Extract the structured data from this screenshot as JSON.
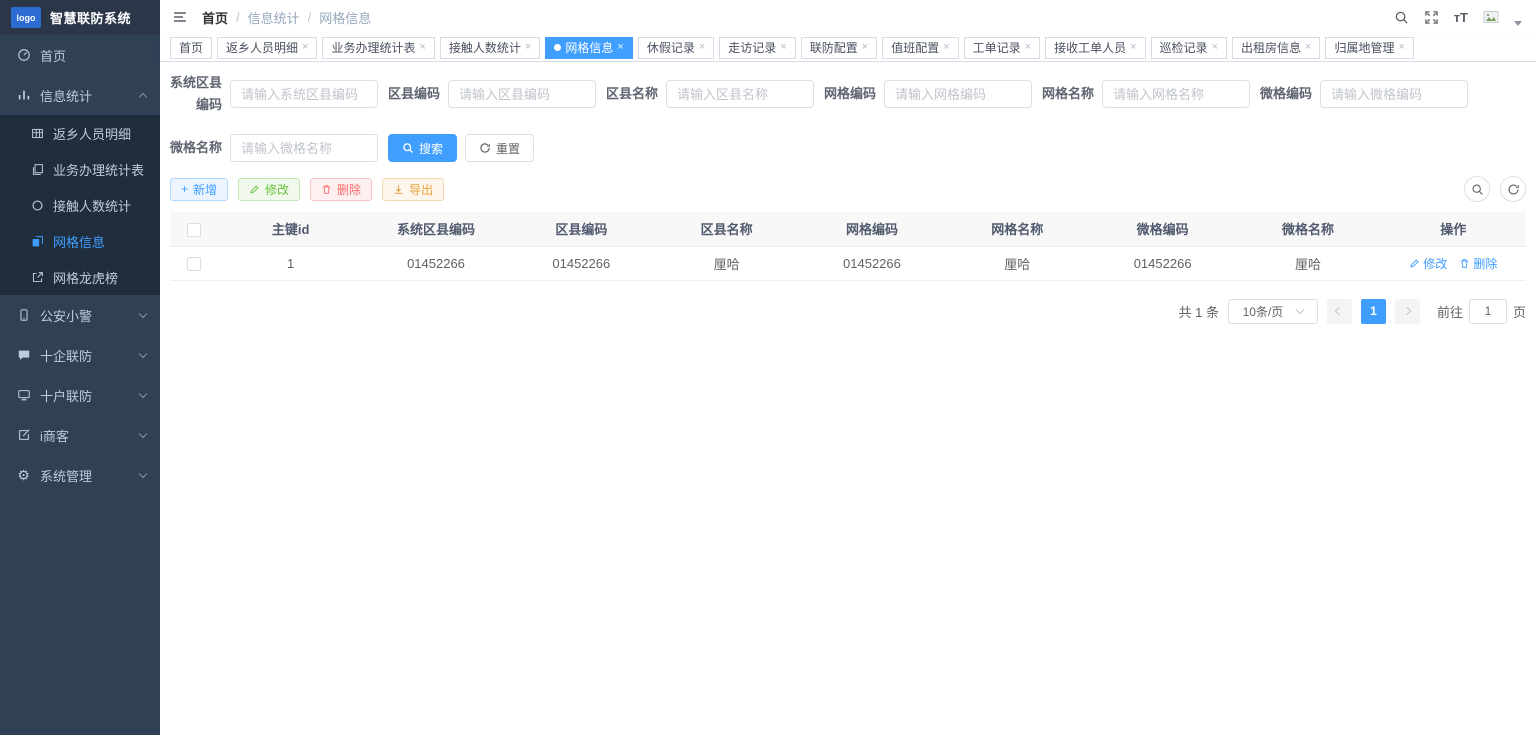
{
  "app": {
    "logo_text": "logo",
    "title": "智慧联防系统"
  },
  "sidebar": {
    "home": "首页",
    "info_stats": "信息统计",
    "info_children": [
      "返乡人员明细",
      "业务办理统计表",
      "接触人数统计",
      "网格信息",
      "网格龙虎榜"
    ],
    "active_child": "网格信息",
    "groups": [
      "公安小警",
      "十企联防",
      "十户联防",
      "i商客",
      "系统管理"
    ]
  },
  "breadcrumb": [
    "首页",
    "信息统计",
    "网格信息"
  ],
  "tabs": [
    "首页",
    "返乡人员明细",
    "业务办理统计表",
    "接触人数统计",
    "网格信息",
    "休假记录",
    "走访记录",
    "联防配置",
    "值班配置",
    "工单记录",
    "接收工单人员",
    "巡检记录",
    "出租房信息",
    "归属地管理"
  ],
  "active_tab": "网格信息",
  "filters": {
    "fields": [
      {
        "label": "系统区县编码",
        "placeholder": "请输入系统区县编码"
      },
      {
        "label": "区县编码",
        "placeholder": "请输入区县编码"
      },
      {
        "label": "区县名称",
        "placeholder": "请输入区县名称"
      },
      {
        "label": "网格编码",
        "placeholder": "请输入网格编码"
      },
      {
        "label": "网格名称",
        "placeholder": "请输入网格名称"
      },
      {
        "label": "微格编码",
        "placeholder": "请输入微格编码"
      },
      {
        "label": "微格名称",
        "placeholder": "请输入微格名称"
      }
    ],
    "search": "搜索",
    "reset": "重置"
  },
  "toolbar": {
    "add": "新增",
    "edit": "修改",
    "del": "删除",
    "export": "导出"
  },
  "table": {
    "columns": [
      "主键id",
      "系统区县编码",
      "区县编码",
      "区县名称",
      "网格编码",
      "网格名称",
      "微格编码",
      "微格名称",
      "操作"
    ],
    "rows": [
      {
        "cells": [
          "1",
          "01452266",
          "01452266",
          "厘哈",
          "01452266",
          "厘哈",
          "01452266",
          "厘哈"
        ],
        "edit": "修改",
        "del": "删除"
      }
    ]
  },
  "pagination": {
    "total": "共 1 条",
    "size": "10条/页",
    "page": "1",
    "goto": "前往",
    "unit": "页",
    "goto_value": "1"
  },
  "glyphs": {
    "close": "×",
    "plus": "+",
    "font_size": "тT",
    "slash": "/"
  },
  "colors": {
    "accent": "#409eff",
    "sidebar_bg": "#304156",
    "submenu_bg": "#1f2d3d",
    "sidebar_header_bg": "#2b3649",
    "logo_blue": "#2c6bd2",
    "success": "#67c23a",
    "danger": "#f56c6c",
    "warning": "#e6a23c",
    "table_header_bg": "#f8f8f9",
    "border": "#dcdfe6"
  },
  "icons": [
    "menu-icon",
    "search-icon",
    "fullscreen-icon",
    "font-size-icon",
    "avatar-image",
    "caret-down-icon",
    "dashboard-icon",
    "bar-chart-icon",
    "grid-icon",
    "doc-stack-icon",
    "circle-icon",
    "files-icon",
    "external-link-icon",
    "phone-icon",
    "chat-icon",
    "monitor-icon",
    "edit-square-icon",
    "gear-icon",
    "plus-icon",
    "pencil-icon",
    "trash-icon",
    "download-icon",
    "refresh-icon",
    "close-icon",
    "checkbox"
  ]
}
